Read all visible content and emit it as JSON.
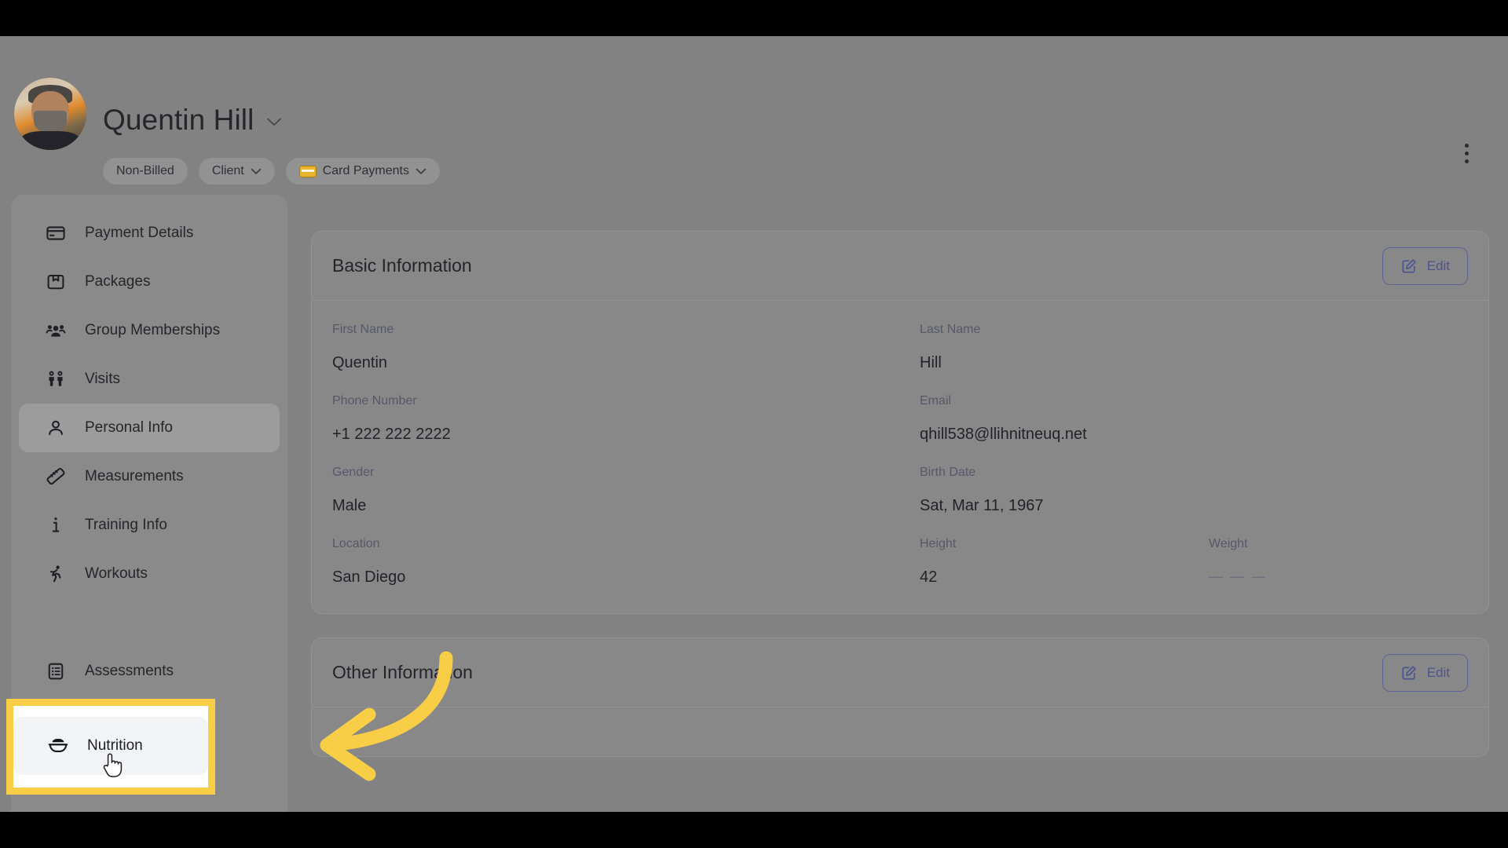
{
  "header": {
    "client_name": "Quentin Hill",
    "name_chevron": "chevron-down-icon",
    "badges": [
      {
        "label": "Non-Billed",
        "has_chevron": false,
        "has_card_icon": false
      },
      {
        "label": "Client",
        "has_chevron": true,
        "has_card_icon": false
      },
      {
        "label": "Card Payments",
        "has_chevron": true,
        "has_card_icon": true
      }
    ],
    "chevron_glyph": "⌄",
    "kebab_label": "more-options"
  },
  "sidebar": {
    "items": [
      {
        "label": "Payment Details",
        "icon": "credit-card-icon",
        "active": false
      },
      {
        "label": "Packages",
        "icon": "package-box-icon",
        "active": false
      },
      {
        "label": "Group Memberships",
        "icon": "people-group-icon",
        "active": false
      },
      {
        "label": "Visits",
        "icon": "two-persons-icon",
        "active": false
      },
      {
        "label": "Personal Info",
        "icon": "person-icon",
        "active": true
      },
      {
        "label": "Measurements",
        "icon": "ruler-icon",
        "active": false
      },
      {
        "label": "Training Info",
        "icon": "info-icon",
        "active": false
      },
      {
        "label": "Workouts",
        "icon": "running-person-icon",
        "active": false
      },
      {
        "label": "Nutrition",
        "icon": "food-bowl-icon",
        "active": false
      },
      {
        "label": "Assessments",
        "icon": "clipboard-list-icon",
        "active": false
      }
    ]
  },
  "main": {
    "cards": [
      {
        "title": "Basic Information",
        "edit_label": "Edit",
        "rows": [
          [
            {
              "label": "First Name",
              "value": "Quentin",
              "muted": false
            },
            {
              "label": "Last Name",
              "value": "Hill",
              "muted": false
            }
          ],
          [
            {
              "label": "Phone Number",
              "value": "+1 222 222 2222",
              "muted": false
            },
            {
              "label": "Email",
              "value": "qhill538@llihnitneuq.net",
              "muted": false
            }
          ],
          [
            {
              "label": "Gender",
              "value": "Male",
              "muted": false
            },
            {
              "label": "Birth Date",
              "value": "Sat, Mar 11, 1967",
              "muted": false
            }
          ],
          [
            {
              "label": "Location",
              "value": "San Diego",
              "muted": false
            },
            {
              "label": "Height",
              "value": "42",
              "muted": false
            },
            {
              "label": "Weight",
              "value": "— — —",
              "muted": true
            }
          ]
        ]
      },
      {
        "title": "Other Information",
        "edit_label": "Edit",
        "rows": []
      }
    ]
  },
  "annotation": {
    "highlight_target": "Nutrition",
    "highlight_color": "#F8CE46",
    "arrow_color": "#F8CE46",
    "arrow_direction": "left"
  }
}
